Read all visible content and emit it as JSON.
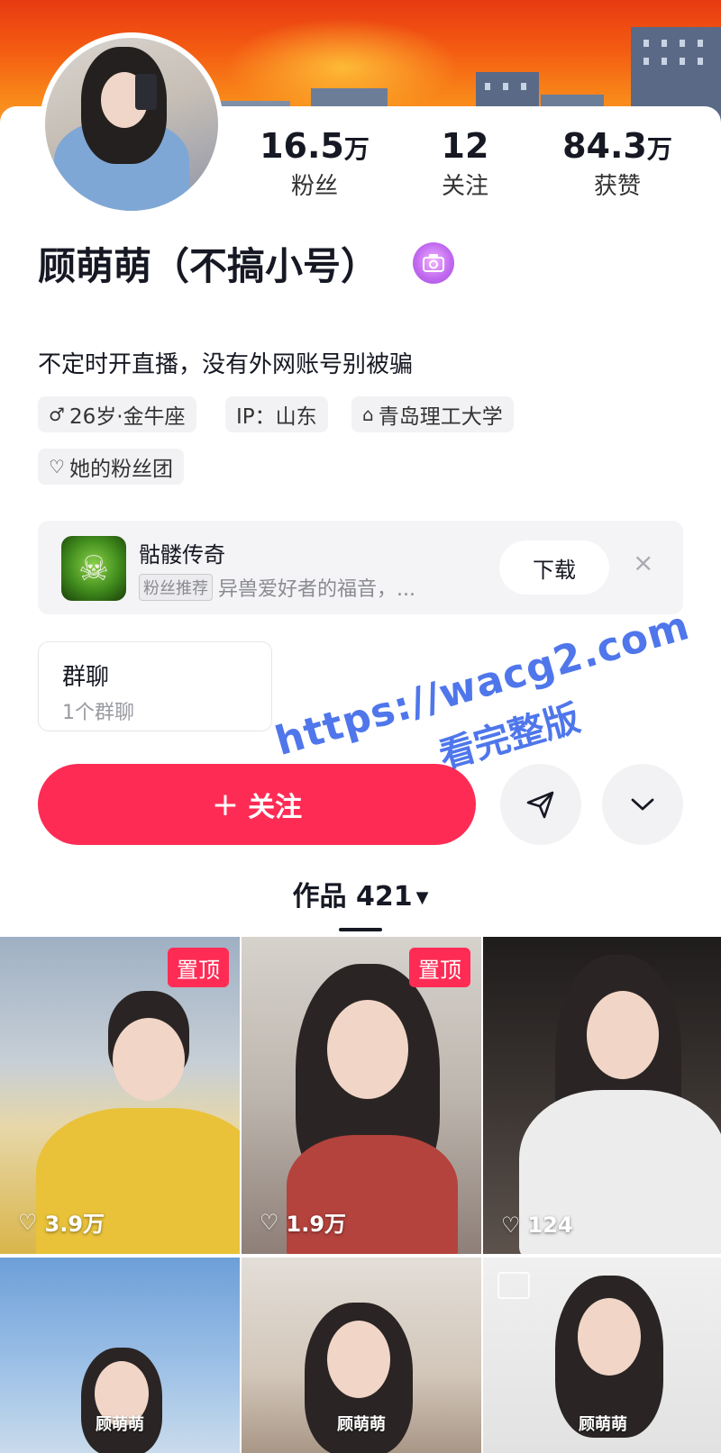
{
  "profile": {
    "name": "顾萌萌（不搞小号）",
    "bio": "不定时开直播，没有外网账号别被骗",
    "stats": [
      {
        "num": "16.5",
        "unit": "万",
        "label": "粉丝"
      },
      {
        "num": "12",
        "unit": "",
        "label": "关注"
      },
      {
        "num": "84.3",
        "unit": "万",
        "label": "获赞"
      }
    ],
    "tags": [
      {
        "icon": "♂",
        "text": "26岁·金牛座"
      },
      {
        "icon": "",
        "text": "IP：山东"
      },
      {
        "icon": "⌂",
        "text": "青岛理工大学"
      },
      {
        "icon": "♡",
        "text": "她的粉丝团"
      }
    ]
  },
  "ad": {
    "title": "骷髅传奇",
    "tag": "粉丝推荐",
    "desc": "异兽爱好者的福音，...",
    "button": "下载",
    "close": "×"
  },
  "group": {
    "title": "群聊",
    "subtitle": "1个群聊"
  },
  "actions": {
    "follow": "关注",
    "follow_plus": "+"
  },
  "works_tab": {
    "label": "作品 421",
    "caret": "▼"
  },
  "watermark": {
    "line1": "https://wacg2.com",
    "line2": "看完整版"
  },
  "grid": [
    {
      "pin": "置顶",
      "likes": "3.9万",
      "caption": ""
    },
    {
      "pin": "置顶",
      "likes": "1.9万",
      "caption": ""
    },
    {
      "pin": "",
      "likes": "124",
      "caption": ""
    },
    {
      "pin": "",
      "likes": "",
      "caption": "顾萌萌"
    },
    {
      "pin": "",
      "likes": "",
      "caption": "顾萌萌"
    },
    {
      "pin": "",
      "likes": "",
      "caption": "顾萌萌"
    }
  ],
  "colors": {
    "accent": "#fe2c55",
    "text": "#161823",
    "watermark": "#1e50e6"
  }
}
